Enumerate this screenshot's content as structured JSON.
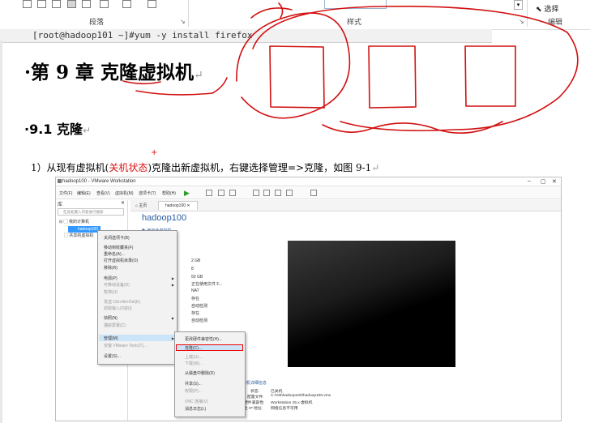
{
  "ribbon": {
    "paragraph_group_label": "段落",
    "styles_group_label": "样式",
    "select_label": "选择",
    "edit_group_label": "编辑"
  },
  "code": {
    "command": "[root@hadoop101 ~]#yum -y install firefox"
  },
  "document": {
    "heading1": "第 9 章 克隆虚拟机",
    "heading2": "9.1 克隆",
    "step_number": "1）",
    "step_text_a": "从现有虚拟机(",
    "step_text_red": "关机状态",
    "step_text_b": ")克隆出新虚拟机，右键选择管理=>克隆，如图 9-1",
    "para_mark": "↵",
    "plus_mark": "+"
  },
  "vmware": {
    "window_title": "hadoop100 - VMware Workstation",
    "menu": [
      "文件(F)",
      "编辑(E)",
      "查看(V)",
      "虚拟机(M)",
      "选项卡(T)",
      "帮助(H)"
    ],
    "library_title": "库",
    "search_placeholder": "在此处键入内容进行搜索",
    "tree": {
      "my_computer": "我的计算机",
      "selected_vm": "hadoop100",
      "shared": "共享的虚拟机"
    },
    "tabs": [
      "主页",
      "hadoop100"
    ],
    "vm_name": "hadoop100",
    "devices_link": "▶ 开启此虚拟机",
    "device_values": [
      "2 GB",
      "8",
      "50 GB",
      "正在使用文件 F...",
      "NAT",
      "存在",
      "自动检测",
      "存在",
      "自动检测"
    ],
    "context_menu": [
      {
        "label": "关闭选项卡(B)",
        "disabled": false,
        "sub": false
      },
      {
        "label": "移动到收藏夹(F)",
        "disabled": false,
        "sub": false
      },
      {
        "label": "重命名(A)...",
        "disabled": false,
        "sub": false
      },
      {
        "label": "打开虚拟机目录(O)",
        "disabled": false,
        "sub": false
      },
      {
        "label": "移除(R)",
        "disabled": false,
        "sub": false
      },
      {
        "label": "电源(P)",
        "disabled": false,
        "sub": true
      },
      {
        "label": "可移动设备(D)",
        "disabled": true,
        "sub": true
      },
      {
        "label": "暂停(U)",
        "disabled": true,
        "sub": false
      },
      {
        "label": "发送 Ctrl+Alt+Del(E)",
        "disabled": true,
        "sub": false
      },
      {
        "label": "抓取输入内容(I)",
        "disabled": true,
        "sub": false
      },
      {
        "label": "快照(N)",
        "disabled": false,
        "sub": true
      },
      {
        "label": "捕获屏幕(C)",
        "disabled": true,
        "sub": false
      },
      {
        "label": "管理(M)",
        "disabled": false,
        "sub": true
      },
      {
        "label": "安装 VMware Tools(T)...",
        "disabled": true,
        "sub": false
      },
      {
        "label": "设置(S)...",
        "disabled": false,
        "sub": false
      }
    ],
    "submenu": [
      {
        "label": "更改硬件兼容性(H)...",
        "disabled": false
      },
      {
        "label": "克隆(C)...",
        "disabled": false
      },
      {
        "label": "上载(U)...",
        "disabled": true
      },
      {
        "label": "下载(W)...",
        "disabled": true
      },
      {
        "label": "从磁盘中删除(D)",
        "disabled": false
      },
      {
        "label": "共享(S)...",
        "disabled": false
      },
      {
        "label": "权限(P)...",
        "disabled": true
      },
      {
        "label": "VNC 连接(V)",
        "disabled": true
      },
      {
        "label": "消息日志(L)",
        "disabled": false
      }
    ],
    "details_title": "虚拟机详细信息",
    "details": [
      {
        "k": "状态:",
        "v": "已关机"
      },
      {
        "k": "配置文件:",
        "v": "C:\\VM\\hadoop100\\hadoop100.vmx"
      },
      {
        "k": "硬件兼容性:",
        "v": "Workstation 15.x 虚拟机"
      },
      {
        "k": "主 IP 地址:",
        "v": "网络信息不可用"
      }
    ]
  },
  "colors": {
    "annotation_red": "#d11111",
    "selection_blue": "#3399ff",
    "accent_link": "#2a5d9f"
  }
}
